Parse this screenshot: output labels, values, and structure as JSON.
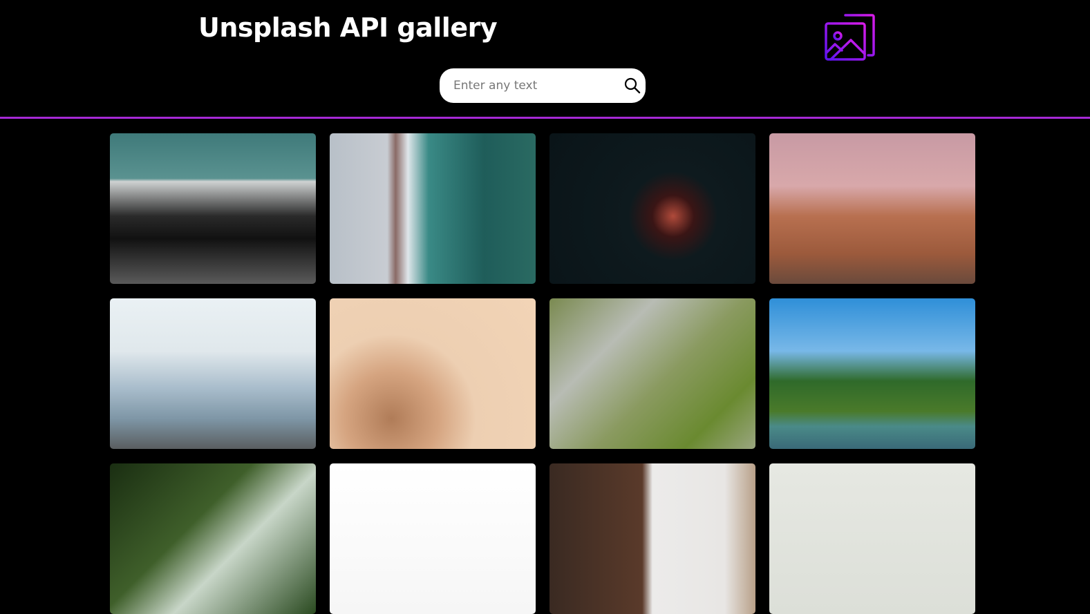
{
  "header": {
    "title": "Unsplash API gallery",
    "logo_icon": "images-gallery-icon",
    "accent_color": "#a629d6"
  },
  "search": {
    "placeholder": "Enter any text",
    "value": "",
    "icon": "search-icon"
  },
  "gallery": {
    "images": [
      {
        "bg": "linear-gradient(180deg,#3f7a7a 0%,#5a9290 30%,#cfd2d2 32%,#2a2a2a 55%,#111 70%,#5a5a5a 100%)"
      },
      {
        "bg": "linear-gradient(90deg,#b8c0c8 0%,#c8ccd2 28%,#8a6a66 32%,#dfe6ea 38%,#3a8a86 48%,#1f5d5a 75%,#2a6a62 100%)"
      },
      {
        "bg": "radial-gradient(circle at 60% 55%,#b04a3a 0%,#3a1515 14%,#0e1a1e 30%,#0a1418 100%)"
      },
      {
        "bg": "linear-gradient(180deg,#c89aa4 0%,#d8a8aa 35%,#b87050 55%,#9c5a3c 80%,#6a4a3c 100%)"
      },
      {
        "bg": "linear-gradient(180deg,#eaf1f4 0%,#e0e8ec 35%,#a8bccb 60%,#7e96a6 80%,#5a5e60 100%)"
      },
      {
        "bg": "radial-gradient(circle at 30% 80%,#b07c58 0%,#d5a480 25%,#edcfb2 45%,#f2d4b6 100%)"
      },
      {
        "bg": "linear-gradient(135deg,#7a8a50 0%,#b8bcb4 30%,#8a9a60 55%,#6a8a30 80%,#9aa680 100%)"
      },
      {
        "bg": "linear-gradient(180deg,#2f8fd8 0%,#78b8e8 35%,#2f6a2a 55%,#4a7a2a 75%,#4a8a88 85%,#3a6a78 100%)"
      },
      {
        "bg": "linear-gradient(135deg,#1a2e12 0%,#3f5f2a 40%,#c8d6c8 60%,#2a4a20 100%)"
      },
      {
        "bg": "linear-gradient(180deg,#ffffff 0%,#f6f6f6 100%)"
      },
      {
        "bg": "linear-gradient(90deg,#3a2a22 0%,#5a3a2a 45%,#ecebea 50%,#e8e6e4 85%,#b8a088 100%)"
      },
      {
        "bg": "linear-gradient(180deg,#e6e8e2 0%,#dcdfd8 100%)"
      }
    ]
  }
}
